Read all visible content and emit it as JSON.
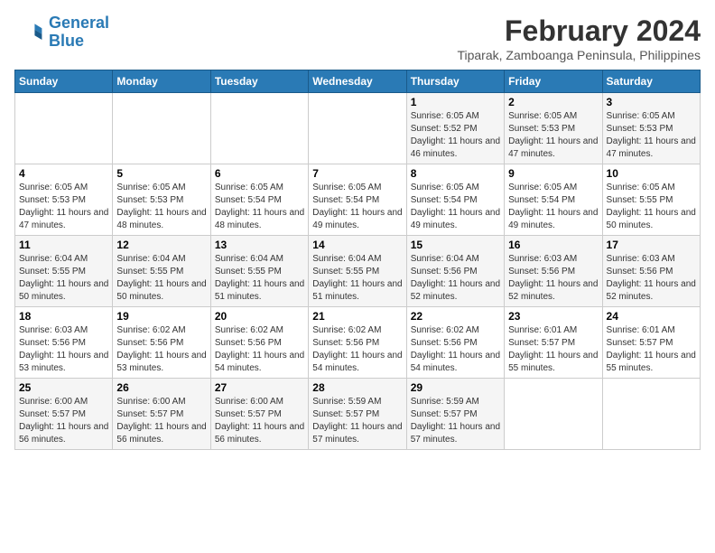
{
  "header": {
    "logo_line1": "General",
    "logo_line2": "Blue",
    "title": "February 2024",
    "subtitle": "Tiparak, Zamboanga Peninsula, Philippines"
  },
  "days_of_week": [
    "Sunday",
    "Monday",
    "Tuesday",
    "Wednesday",
    "Thursday",
    "Friday",
    "Saturday"
  ],
  "weeks": [
    {
      "cells": [
        {
          "day": "",
          "content": ""
        },
        {
          "day": "",
          "content": ""
        },
        {
          "day": "",
          "content": ""
        },
        {
          "day": "",
          "content": ""
        },
        {
          "day": "1",
          "content": "Sunrise: 6:05 AM\nSunset: 5:52 PM\nDaylight: 11 hours and 46 minutes."
        },
        {
          "day": "2",
          "content": "Sunrise: 6:05 AM\nSunset: 5:53 PM\nDaylight: 11 hours and 47 minutes."
        },
        {
          "day": "3",
          "content": "Sunrise: 6:05 AM\nSunset: 5:53 PM\nDaylight: 11 hours and 47 minutes."
        }
      ]
    },
    {
      "cells": [
        {
          "day": "4",
          "content": "Sunrise: 6:05 AM\nSunset: 5:53 PM\nDaylight: 11 hours and 47 minutes."
        },
        {
          "day": "5",
          "content": "Sunrise: 6:05 AM\nSunset: 5:53 PM\nDaylight: 11 hours and 48 minutes."
        },
        {
          "day": "6",
          "content": "Sunrise: 6:05 AM\nSunset: 5:54 PM\nDaylight: 11 hours and 48 minutes."
        },
        {
          "day": "7",
          "content": "Sunrise: 6:05 AM\nSunset: 5:54 PM\nDaylight: 11 hours and 49 minutes."
        },
        {
          "day": "8",
          "content": "Sunrise: 6:05 AM\nSunset: 5:54 PM\nDaylight: 11 hours and 49 minutes."
        },
        {
          "day": "9",
          "content": "Sunrise: 6:05 AM\nSunset: 5:54 PM\nDaylight: 11 hours and 49 minutes."
        },
        {
          "day": "10",
          "content": "Sunrise: 6:05 AM\nSunset: 5:55 PM\nDaylight: 11 hours and 50 minutes."
        }
      ]
    },
    {
      "cells": [
        {
          "day": "11",
          "content": "Sunrise: 6:04 AM\nSunset: 5:55 PM\nDaylight: 11 hours and 50 minutes."
        },
        {
          "day": "12",
          "content": "Sunrise: 6:04 AM\nSunset: 5:55 PM\nDaylight: 11 hours and 50 minutes."
        },
        {
          "day": "13",
          "content": "Sunrise: 6:04 AM\nSunset: 5:55 PM\nDaylight: 11 hours and 51 minutes."
        },
        {
          "day": "14",
          "content": "Sunrise: 6:04 AM\nSunset: 5:55 PM\nDaylight: 11 hours and 51 minutes."
        },
        {
          "day": "15",
          "content": "Sunrise: 6:04 AM\nSunset: 5:56 PM\nDaylight: 11 hours and 52 minutes."
        },
        {
          "day": "16",
          "content": "Sunrise: 6:03 AM\nSunset: 5:56 PM\nDaylight: 11 hours and 52 minutes."
        },
        {
          "day": "17",
          "content": "Sunrise: 6:03 AM\nSunset: 5:56 PM\nDaylight: 11 hours and 52 minutes."
        }
      ]
    },
    {
      "cells": [
        {
          "day": "18",
          "content": "Sunrise: 6:03 AM\nSunset: 5:56 PM\nDaylight: 11 hours and 53 minutes."
        },
        {
          "day": "19",
          "content": "Sunrise: 6:02 AM\nSunset: 5:56 PM\nDaylight: 11 hours and 53 minutes."
        },
        {
          "day": "20",
          "content": "Sunrise: 6:02 AM\nSunset: 5:56 PM\nDaylight: 11 hours and 54 minutes."
        },
        {
          "day": "21",
          "content": "Sunrise: 6:02 AM\nSunset: 5:56 PM\nDaylight: 11 hours and 54 minutes."
        },
        {
          "day": "22",
          "content": "Sunrise: 6:02 AM\nSunset: 5:56 PM\nDaylight: 11 hours and 54 minutes."
        },
        {
          "day": "23",
          "content": "Sunrise: 6:01 AM\nSunset: 5:57 PM\nDaylight: 11 hours and 55 minutes."
        },
        {
          "day": "24",
          "content": "Sunrise: 6:01 AM\nSunset: 5:57 PM\nDaylight: 11 hours and 55 minutes."
        }
      ]
    },
    {
      "cells": [
        {
          "day": "25",
          "content": "Sunrise: 6:00 AM\nSunset: 5:57 PM\nDaylight: 11 hours and 56 minutes."
        },
        {
          "day": "26",
          "content": "Sunrise: 6:00 AM\nSunset: 5:57 PM\nDaylight: 11 hours and 56 minutes."
        },
        {
          "day": "27",
          "content": "Sunrise: 6:00 AM\nSunset: 5:57 PM\nDaylight: 11 hours and 56 minutes."
        },
        {
          "day": "28",
          "content": "Sunrise: 5:59 AM\nSunset: 5:57 PM\nDaylight: 11 hours and 57 minutes."
        },
        {
          "day": "29",
          "content": "Sunrise: 5:59 AM\nSunset: 5:57 PM\nDaylight: 11 hours and 57 minutes."
        },
        {
          "day": "",
          "content": ""
        },
        {
          "day": "",
          "content": ""
        }
      ]
    }
  ]
}
